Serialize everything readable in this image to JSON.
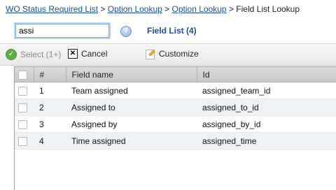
{
  "breadcrumb": {
    "links": [
      "WO Status Required List",
      "Option Lookup",
      "Option Lookup"
    ],
    "separator": ">",
    "current": "Field List Lookup"
  },
  "search": {
    "value": "assi"
  },
  "help_icon": {
    "glyph": "?"
  },
  "list_title": "Field List (4)",
  "toolbar": {
    "select_label": "Select (1+)",
    "cancel_label": "Cancel",
    "customize_label": "Customize"
  },
  "table": {
    "columns": [
      "",
      "#",
      "Field name",
      "Id"
    ],
    "rows": [
      {
        "num": "1",
        "name": "Team assigned",
        "id": "assigned_team_id"
      },
      {
        "num": "2",
        "name": "Assigned to",
        "id": "assigned_to_id"
      },
      {
        "num": "3",
        "name": "Assigned by",
        "id": "assigned_by_id"
      },
      {
        "num": "4",
        "name": "Time assigned",
        "id": "assigned_time"
      }
    ]
  },
  "colors": {
    "link": "#1a4fa3",
    "accent_green": "#5fae3f"
  }
}
